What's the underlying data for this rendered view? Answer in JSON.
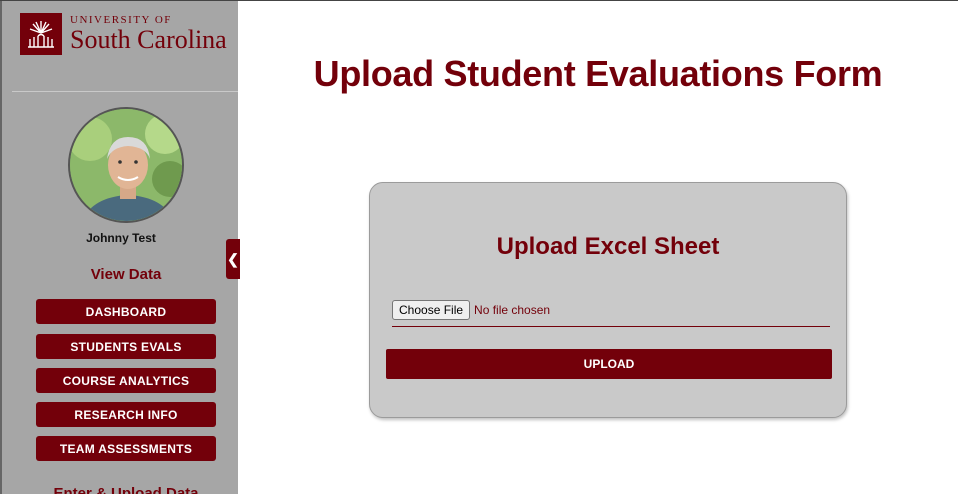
{
  "brand": {
    "line1": "UNIVERSITY OF",
    "line2": "South Carolina",
    "color": "#73000a"
  },
  "sidebar": {
    "user_name": "Johnny Test",
    "view_section": "View Data",
    "nav_items": [
      {
        "label": "DASHBOARD"
      },
      {
        "label": "STUDENTS EVALS"
      },
      {
        "label": "COURSE ANALYTICS"
      },
      {
        "label": "RESEARCH INFO"
      },
      {
        "label": "TEAM ASSESSMENTS"
      }
    ],
    "enter_section": "Enter & Upload Data",
    "collapse_glyph": "❮"
  },
  "main": {
    "title": "Upload Student Evaluations Form",
    "card": {
      "title": "Upload Excel Sheet",
      "choose_file_label": "Choose File",
      "file_status": "No file chosen",
      "upload_label": "UPLOAD"
    }
  },
  "icons": {
    "logo": "university-seal-icon",
    "collapse": "chevron-left-icon"
  }
}
